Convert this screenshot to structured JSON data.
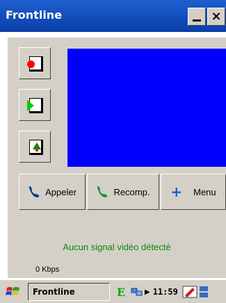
{
  "window": {
    "title": "Frontline",
    "minimize_icon": "minimize-icon",
    "close_label": "×"
  },
  "side_buttons": [
    {
      "name": "record-button",
      "icon": "record-icon"
    },
    {
      "name": "play-button",
      "icon": "play-icon"
    },
    {
      "name": "snapshot-button",
      "icon": "picture-icon"
    }
  ],
  "video": {
    "color": "#0000ff"
  },
  "actions": {
    "call_label": "Appeler",
    "redial_label": "Recomp.",
    "menu_label": "Menu",
    "menu_icon": "+"
  },
  "status": {
    "message": "Aucun signal vidéo détecté",
    "bitrate": "0 Kbps"
  },
  "taskbar": {
    "task_label": "Frontline",
    "edge_label": "E",
    "clock": "11:59"
  },
  "colors": {
    "titlebar": "#0a3fa8",
    "status_text": "#0a8a0a",
    "panel": "#d4d0c8"
  }
}
